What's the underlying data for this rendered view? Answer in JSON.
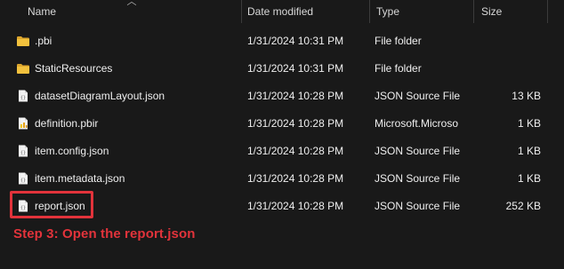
{
  "header": {
    "columns": {
      "name": "Name",
      "date": "Date modified",
      "type": "Type",
      "size": "Size"
    },
    "sort_indicator": "chevron-up-icon"
  },
  "rows": [
    {
      "name": ".pbi",
      "date": "1/31/2024 10:31 PM",
      "type": "File folder",
      "size": "",
      "icon": "folder-icon"
    },
    {
      "name": "StaticResources",
      "date": "1/31/2024 10:31 PM",
      "type": "File folder",
      "size": "",
      "icon": "folder-icon"
    },
    {
      "name": "datasetDiagramLayout.json",
      "date": "1/31/2024 10:28 PM",
      "type": "JSON Source File",
      "size": "13 KB",
      "icon": "json-file-icon"
    },
    {
      "name": "definition.pbir",
      "date": "1/31/2024 10:28 PM",
      "type": "Microsoft.Microso",
      "size": "1 KB",
      "icon": "pbir-file-icon"
    },
    {
      "name": "item.config.json",
      "date": "1/31/2024 10:28 PM",
      "type": "JSON Source File",
      "size": "1 KB",
      "icon": "json-file-icon"
    },
    {
      "name": "item.metadata.json",
      "date": "1/31/2024 10:28 PM",
      "type": "JSON Source File",
      "size": "1 KB",
      "icon": "json-file-icon"
    },
    {
      "name": "report.json",
      "date": "1/31/2024 10:28 PM",
      "type": "JSON Source File",
      "size": "252 KB",
      "icon": "json-file-icon"
    }
  ],
  "annotation": {
    "text": "Step 3: Open the report.json",
    "color": "#e2333b"
  },
  "colors": {
    "background": "#191919",
    "text": "#efefef",
    "header_text": "#d8d8d8",
    "folder": "#f2c13d",
    "file": "#f3f3f3",
    "pbir_accent": "#f2c811",
    "highlight": "#e2333b"
  }
}
